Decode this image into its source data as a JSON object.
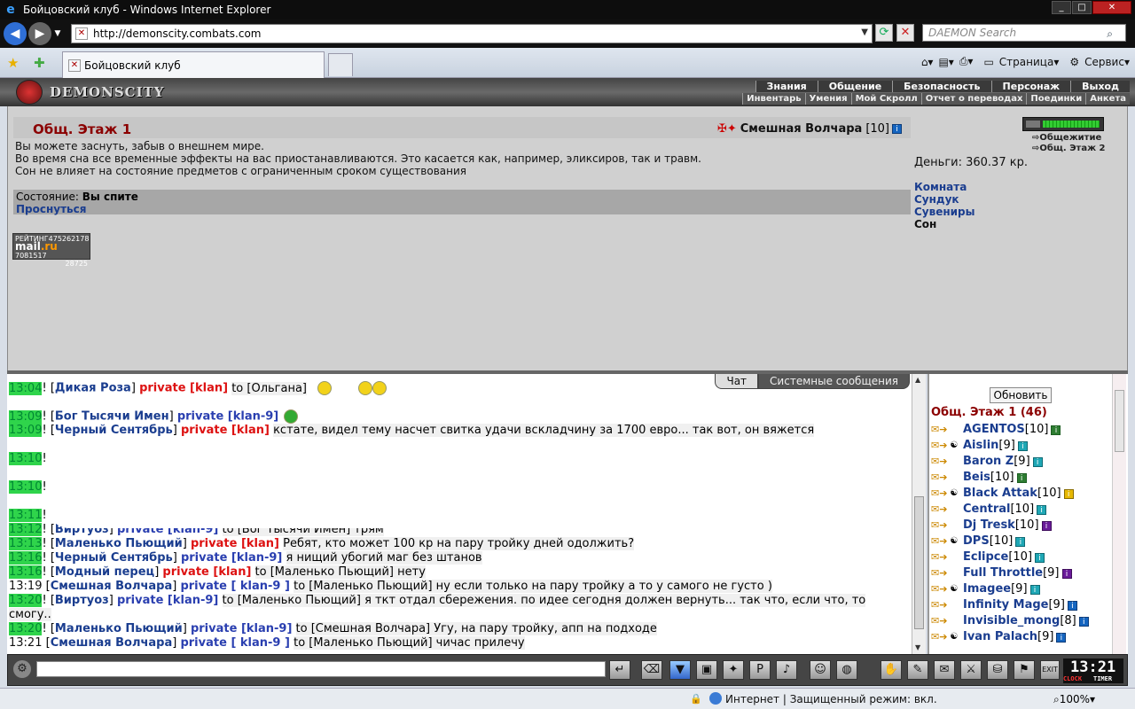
{
  "window": {
    "title": "Бойцовский клуб - Windows Internet Explorer"
  },
  "address": {
    "url": "http://demonscity.combats.com",
    "search_placeholder": "DAEMON Search"
  },
  "tab": {
    "title": "Бойцовский клуб"
  },
  "commands": {
    "page": "Страница",
    "service": "Сервис"
  },
  "game": {
    "logo": "DEMONSCITY",
    "menu_top": [
      "Знания",
      "Общение",
      "Безопасность",
      "Персонаж",
      "Выход"
    ],
    "menu_sub": [
      "Инвентарь",
      "Умения",
      "Мой Скролл",
      "Отчет о переводах",
      "Поединки",
      "Анкета"
    ]
  },
  "room": {
    "title": "Общ. Этаж 1",
    "char_name": "Смешная Волчара",
    "char_level": "[10]",
    "messages": [
      "Вы можете заснуть, забыв о внешнем мире.",
      "Во время сна все временные эффекты на вас приостанавливаются. Это касается как, например, эликсиров, так и травм.",
      "Сон не влияет на состояние предметов с ограниченным сроком существования"
    ],
    "state_label": "Состояние:",
    "state_value": "Вы спите",
    "wake": "Проснуться",
    "money": "Деньги: 360.37 кр.",
    "actions": [
      "Комната",
      "Сундук",
      "Сувениры",
      "Сон"
    ],
    "side_links": [
      "Общежитие",
      "Общ. Этаж 2"
    ],
    "rating": {
      "l1": "РЕЙТИНГ",
      "v1": "475262178",
      "brand1": "mail",
      "brand2": ".ru",
      "v2": "7081517",
      "v3": "28725"
    }
  },
  "chat": {
    "tabs": [
      "Чат",
      "Системные сообщения"
    ],
    "lines": [
      {
        "t": "13:04",
        "n": "Дикая Роза",
        "p": "private [klan]",
        "pc": "red",
        "m": "to [Ольгана]"
      },
      {
        "t": "",
        "n": "",
        "p": "",
        "pc": "",
        "m": ""
      },
      {
        "t": "13:09",
        "n": "Бог Тысячи Имен",
        "p": "private [klan-9]",
        "pc": "blue",
        "m": ""
      },
      {
        "t": "13:09",
        "n": "Черный Сентябрь",
        "p": "private [klan]",
        "pc": "red",
        "m": "кстате, видел тему насчет свитка удачи вскладчину за 1700 евро... так вот, он вяжется"
      },
      {
        "t": "",
        "n": "",
        "p": "",
        "pc": "",
        "m": ""
      },
      {
        "t": "13:10",
        "n": "",
        "p": "",
        "pc": "",
        "m": ""
      },
      {
        "t": "",
        "n": "",
        "p": "",
        "pc": "",
        "m": ""
      },
      {
        "t": "13:10",
        "n": "",
        "p": "",
        "pc": "",
        "m": ""
      },
      {
        "t": "",
        "n": "",
        "p": "",
        "pc": "",
        "m": ""
      },
      {
        "t": "13:11",
        "n": "",
        "p": "",
        "pc": "",
        "m": ""
      },
      {
        "t": "13:12",
        "n": "Виртуоз",
        "p": "private [klan-9]",
        "pc": "blue",
        "m": "to [Бог Тысячи Имен] трям"
      },
      {
        "t": "13:13",
        "n": "Маленько Пьющий",
        "p": "private [klan]",
        "pc": "red",
        "m": "Ребят, кто может 100 кр на пару тройку дней одолжить?"
      },
      {
        "t": "13:16",
        "n": "Черный Сентябрь",
        "p": "private [klan-9]",
        "pc": "blue",
        "m": "я нищий убогий маг без штанов"
      },
      {
        "t": "13:16",
        "n": "Модный перец",
        "p": "private [klan]",
        "pc": "red",
        "m": "to [Маленько Пьющий] нету"
      },
      {
        "t": "13:19",
        "n": "Смешная Волчара",
        "p": "private [ klan-9 ]",
        "pc": "blue",
        "m": "to [Маленько Пьющий] ну если только на пару тройку а то у самого не густо )",
        "plain": true
      },
      {
        "t": "13:20",
        "n": "Виртуоз",
        "p": "private [klan-9]",
        "pc": "blue",
        "m": "to [Маленько Пьющий] я ткт отдал сбережения. по идее сегодня должен вернуть... так что, если что, то смогу..",
        "wrap": true
      },
      {
        "t": "13:20",
        "n": "Маленько Пьющий",
        "p": "private [klan-9]",
        "pc": "blue",
        "m": "to [Смешная Волчара] Угу, на пару тройку, апп на подходе"
      },
      {
        "t": "13:21",
        "n": "Смешная Волчара",
        "p": "private [ klan-9 ]",
        "pc": "blue",
        "m": "to [Маленько Пьющий] чичас прилечу",
        "plain": true
      }
    ]
  },
  "users": {
    "refresh": "Обновить",
    "room_count": "Общ. Этаж 1 (46)",
    "list": [
      {
        "name": "AGENTOS",
        "lvl": "[10]",
        "ic": "g"
      },
      {
        "name": "Aislin",
        "lvl": "[9]",
        "ic": "c"
      },
      {
        "name": "Baron Z",
        "lvl": "[9]",
        "ic": "c"
      },
      {
        "name": "Beis",
        "lvl": "[10]",
        "ic": "g"
      },
      {
        "name": "Black Attak",
        "lvl": "[10]",
        "ic": "y"
      },
      {
        "name": "Central",
        "lvl": "[10]",
        "ic": "c"
      },
      {
        "name": "Dj Tresk",
        "lvl": "[10]",
        "ic": "p"
      },
      {
        "name": "DPS",
        "lvl": "[10]",
        "ic": "c"
      },
      {
        "name": "Eclipce",
        "lvl": "[10]",
        "ic": "c"
      },
      {
        "name": "Full Throttle",
        "lvl": "[9]",
        "ic": "p"
      },
      {
        "name": "Imagee",
        "lvl": "[9]",
        "ic": "c"
      },
      {
        "name": "Infinity Mage",
        "lvl": "[9]",
        "ic": ""
      },
      {
        "name": "Invisible_mong",
        "lvl": "[8]",
        "ic": ""
      },
      {
        "name": "Ivan Palach",
        "lvl": "[9]",
        "ic": ""
      }
    ]
  },
  "clock": {
    "time": "13:21",
    "l1": "CLOCK",
    "l2": "TIMER"
  },
  "status": {
    "zone": "Интернет | Защищенный режим: вкл.",
    "zoom": "100%"
  },
  "colors": {
    "timestamp_bg": "#2fd44b",
    "nick": "#1a3d8f",
    "private_red": "#d11",
    "private_blue": "#2a3fb0",
    "room_title": "#8b0000"
  },
  "icons": [
    "ie-icon",
    "back-icon",
    "forward-icon",
    "refresh-icon",
    "stop-icon",
    "search-icon",
    "favorites-star-icon",
    "add-favorite-icon",
    "home-icon",
    "feeds-icon",
    "print-icon",
    "page-icon",
    "tools-gear-icon",
    "info-icon",
    "smiley-icon"
  ]
}
